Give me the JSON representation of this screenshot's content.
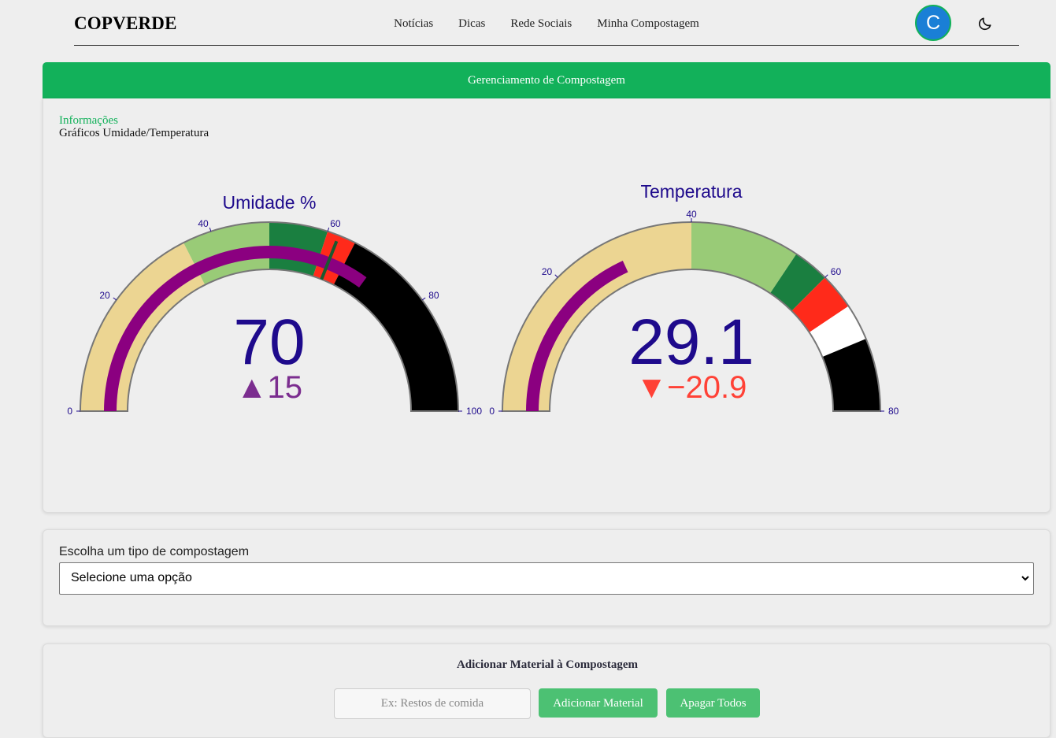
{
  "header": {
    "brand": "COPVERDE",
    "nav": [
      "Notícias",
      "Dicas",
      "Rede Sociais",
      "Minha Compostagem"
    ],
    "avatar_letter": "C"
  },
  "banner": {
    "title": "Gerenciamento de Compostagem"
  },
  "info": {
    "title": "Informações",
    "subtitle": "Gráficos Umidade/Temperatura"
  },
  "chart_data": [
    {
      "type": "gauge",
      "title": "Umidade %",
      "value": 70,
      "value_label": "70",
      "delta": 15,
      "delta_label": "▲15",
      "delta_color": "#7b2d8f",
      "range": [
        0,
        100
      ],
      "ticks": [
        "0",
        "20",
        "40",
        "60",
        "80",
        "100"
      ],
      "threshold": 62,
      "bar_color": "#8b0080",
      "steps": [
        {
          "range": [
            0,
            35
          ],
          "color": "#ecd592"
        },
        {
          "range": [
            35,
            50
          ],
          "color": "#99cb77"
        },
        {
          "range": [
            50,
            60
          ],
          "color": "#1a7f40"
        },
        {
          "range": [
            60,
            65
          ],
          "color": "#ff2a1a"
        },
        {
          "range": [
            65,
            100
          ],
          "color": "#000000"
        }
      ]
    },
    {
      "type": "gauge",
      "title": "Temperatura",
      "value": 29.1,
      "value_label": "29.1",
      "delta": -20.9,
      "delta_label": "▼−20.9",
      "delta_color": "#ff4136",
      "range": [
        0,
        80
      ],
      "ticks": [
        "0",
        "20",
        "40",
        "60",
        "80"
      ],
      "bar_color": "#8b0080",
      "steps": [
        {
          "range": [
            0,
            40
          ],
          "color": "#ecd592"
        },
        {
          "range": [
            40,
            55
          ],
          "color": "#99cb77"
        },
        {
          "range": [
            55,
            60
          ],
          "color": "#1a7f40"
        },
        {
          "range": [
            60,
            65
          ],
          "color": "#ff2a1a"
        },
        {
          "range": [
            65,
            70
          ],
          "color": "#ffffff"
        },
        {
          "range": [
            70,
            80
          ],
          "color": "#000000"
        }
      ]
    }
  ],
  "composting": {
    "label": "Escolha um tipo de compostagem",
    "selected": "Selecione uma opção"
  },
  "materials": {
    "title": "Adicionar Material à Compostagem",
    "placeholder": "Ex: Restos de comida",
    "add_label": "Adicionar Material",
    "clear_label": "Apagar Todos"
  },
  "colors": {
    "accent": "#12b15a",
    "button": "#4cc173",
    "gauge_text": "#1e0a8c"
  }
}
